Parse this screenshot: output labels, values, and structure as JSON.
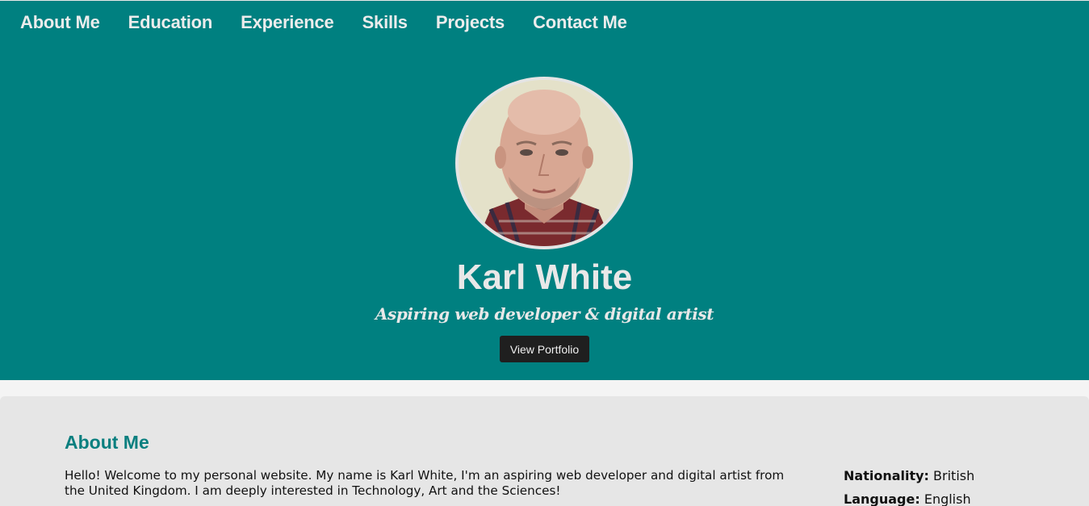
{
  "nav": {
    "items": [
      {
        "label": "About Me"
      },
      {
        "label": "Education"
      },
      {
        "label": "Experience"
      },
      {
        "label": "Skills"
      },
      {
        "label": "Projects"
      },
      {
        "label": "Contact Me"
      }
    ]
  },
  "hero": {
    "name": "Karl White",
    "tagline": "Aspiring web developer & digital artist",
    "button_label": "View Portfolio"
  },
  "about": {
    "title": "About Me",
    "paragraph": "Hello! Welcome to my personal website. My name is Karl White, I'm an aspiring web developer and digital artist from the United Kingdom. I am deeply interested in Technology, Art and the Sciences!",
    "facts": [
      {
        "label": "Nationality:",
        "value": "British"
      },
      {
        "label": "Language:",
        "value": "English"
      }
    ]
  },
  "colors": {
    "brand": "#008080",
    "section_bg": "#e6e6e6",
    "button_bg": "#1f1f1f"
  }
}
